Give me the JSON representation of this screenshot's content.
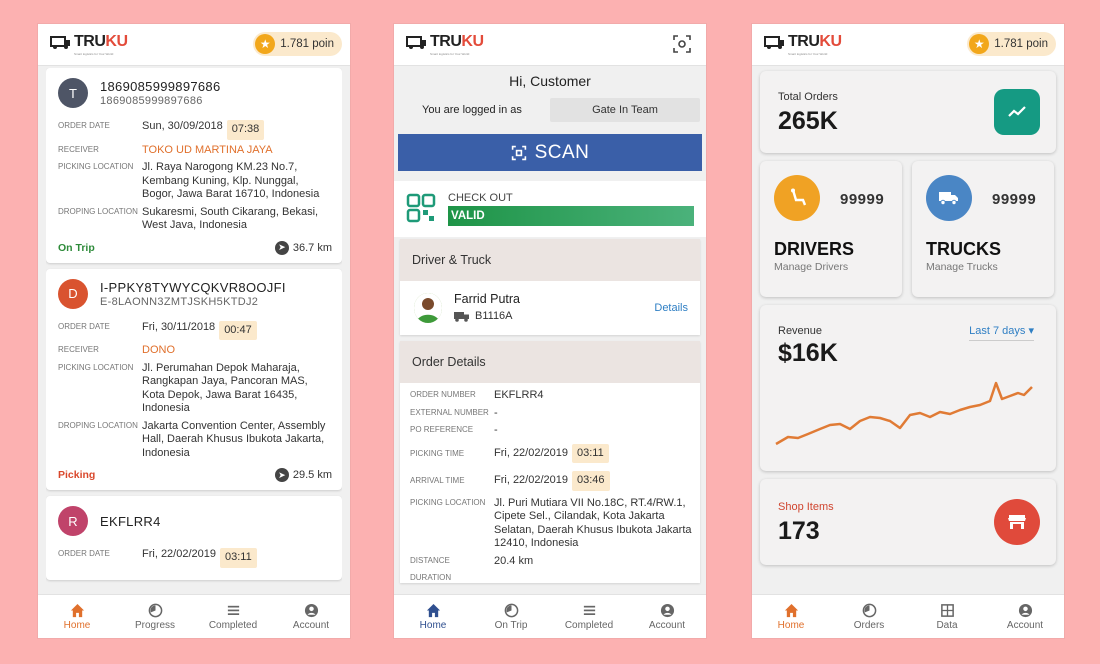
{
  "brand": {
    "truck_part": "TRU",
    "ku_part": "KU",
    "tagline": "Smart logistics for Your World"
  },
  "points": {
    "value": "1.781 poin",
    "icon": "star-icon"
  },
  "orders": [
    {
      "avatar": "T",
      "avatar_color": "#4e5566",
      "title": "1869085999897686",
      "subtitle": "1869085999897686",
      "order_date_label": "ORDER DATE",
      "order_date": "Sun, 30/09/2018",
      "order_time": "07:38",
      "receiver_label": "RECEIVER",
      "receiver": "TOKO UD MARTINA JAYA",
      "picking_label": "PICKING LOCATION",
      "picking": "Jl. Raya Narogong KM.23 No.7, Kembang Kuning, Klp. Nunggal, Bogor, Jawa Barat 16710, Indonesia",
      "drop_label": "DROPING LOCATION",
      "drop": "Sukaresmi, South Cikarang, Bekasi, West Java, Indonesia",
      "status": "On Trip",
      "distance": "36.7 km"
    },
    {
      "avatar": "D",
      "avatar_color": "#d9532f",
      "title": "I-PPKY8TYWYCQKVR8OOJFI",
      "subtitle": "E-8LAONN3ZMTJSKH5KTDJ2",
      "order_date_label": "ORDER DATE",
      "order_date": "Fri, 30/11/2018",
      "order_time": "00:47",
      "receiver_label": "RECEIVER",
      "receiver": "DONO",
      "picking_label": "PICKING LOCATION",
      "picking": "Jl. Perumahan Depok Maharaja, Rangkapan Jaya, Pancoran MAS, Kota Depok, Jawa Barat 16435, Indonesia",
      "drop_label": "DROPING LOCATION",
      "drop": "Jakarta Convention Center, Assembly Hall, Daerah Khusus Ibukota Jakarta, Indonesia",
      "status": "Picking",
      "distance": "29.5 km"
    },
    {
      "avatar": "R",
      "avatar_color": "#c0436a",
      "title": "EKFLRR4",
      "order_date_label": "ORDER DATE",
      "order_date": "Fri, 22/02/2019",
      "order_time": "03:11"
    }
  ],
  "nav1": [
    {
      "label": "Home",
      "icon": "home-icon"
    },
    {
      "label": "Progress",
      "icon": "progress-icon"
    },
    {
      "label": "Completed",
      "icon": "completed-icon"
    },
    {
      "label": "Account",
      "icon": "account-icon"
    }
  ],
  "gate": {
    "greeting": "Hi, Customer",
    "logged_label": "You are logged in as",
    "team": "Gate In Team",
    "scan_label": "SCAN",
    "checkout_label": "CHECK OUT",
    "valid_label": "VALID",
    "driver_section": "Driver & Truck",
    "driver_name": "Farrid Putra",
    "plate": "B1116A",
    "details": "Details",
    "order_section": "Order Details",
    "fields": {
      "order_number_label": "ORDER NUMBER",
      "order_number": "EKFLRR4",
      "external_label": "EXTERNAL NUMBER",
      "external": "-",
      "po_label": "PO REFERENCE",
      "po": "-",
      "picking_time_label": "PICKING TIME",
      "picking_date": "Fri, 22/02/2019",
      "picking_time": "03:11",
      "arrival_label": "ARRIVAL TIME",
      "arrival_date": "Fri, 22/02/2019",
      "arrival_time": "03:46",
      "picking_loc_label": "PICKING LOCATION",
      "picking_loc": "Jl. Puri Mutiara VII No.18C, RT.4/RW.1, Cipete Sel., Cilandak, Kota Jakarta Selatan, Daerah Khusus Ibukota Jakarta 12410, Indonesia",
      "distance_label": "DISTANCE",
      "distance": "20.4 km",
      "duration_label": "DURATION"
    }
  },
  "nav2": [
    {
      "label": "Home",
      "icon": "home-icon"
    },
    {
      "label": "On Trip",
      "icon": "ontrip-icon"
    },
    {
      "label": "Completed",
      "icon": "completed-icon"
    },
    {
      "label": "Account",
      "icon": "account-icon"
    }
  ],
  "dashboard": {
    "total_orders_label": "Total Orders",
    "total_orders": "265K",
    "drivers_count": "99999",
    "drivers_title": "DRIVERS",
    "drivers_sub": "Manage Drivers",
    "trucks_count": "99999",
    "trucks_title": "TRUCKS",
    "trucks_sub": "Manage Trucks",
    "revenue_label": "Revenue",
    "revenue": "$16K",
    "range": "Last 7 days",
    "shop_label": "Shop Items",
    "shop": "173",
    "colors": {
      "teal": "#159a83",
      "orange": "#f0a224",
      "blue": "#4a86c5",
      "red": "#e04a3b",
      "line": "#e07b35"
    }
  },
  "nav3": [
    {
      "label": "Home",
      "icon": "home-icon"
    },
    {
      "label": "Orders",
      "icon": "orders-icon"
    },
    {
      "label": "Data",
      "icon": "data-icon"
    },
    {
      "label": "Account",
      "icon": "account-icon"
    }
  ]
}
